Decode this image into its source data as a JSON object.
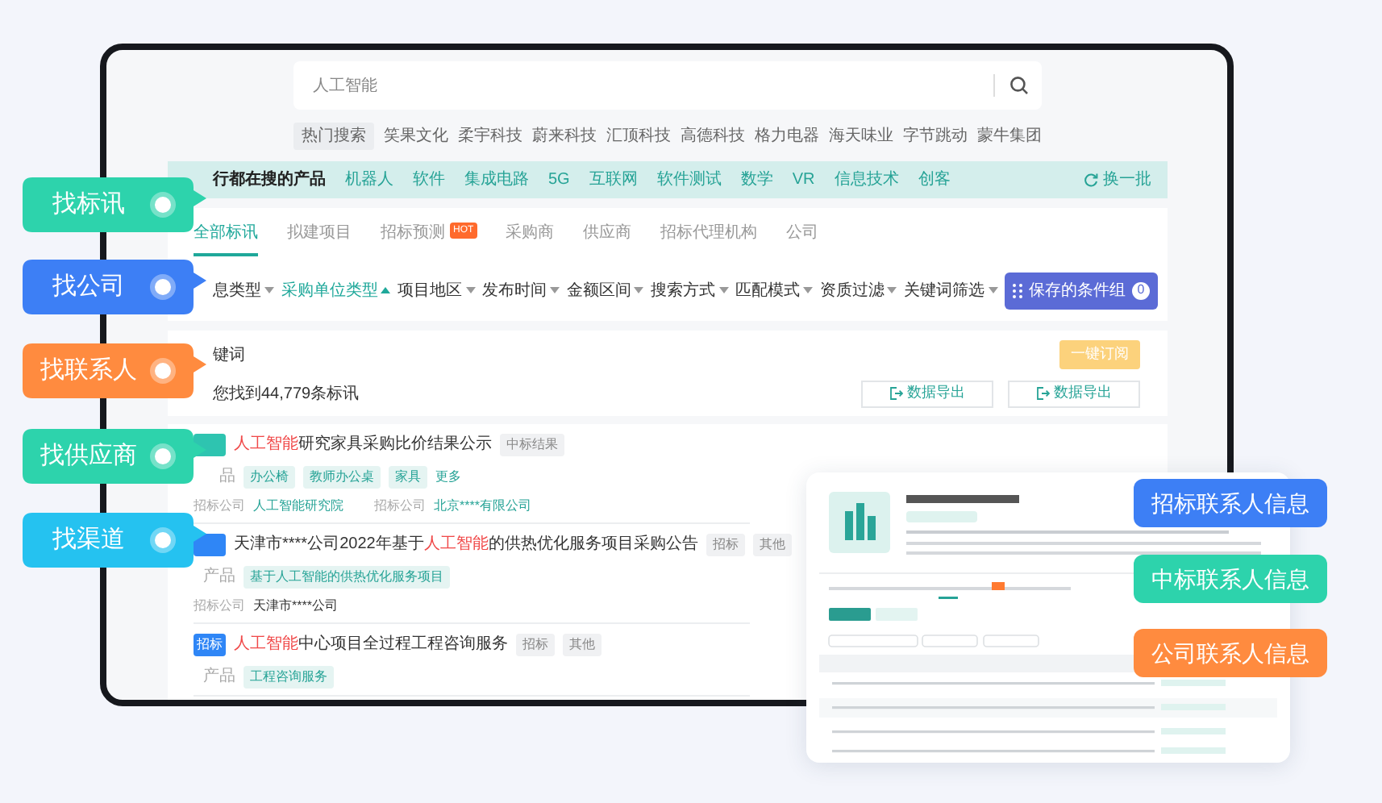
{
  "search": {
    "placeholder": "人工智能"
  },
  "hot_search": {
    "label": "热门搜索",
    "items": [
      "笑果文化",
      "柔宇科技",
      "蔚来科技",
      "汇顶科技",
      "高德科技",
      "格力电器",
      "海天味业",
      "字节跳动",
      "蒙牛集团"
    ]
  },
  "popular_products": {
    "title": "行都在搜的产品",
    "items": [
      "机器人",
      "软件",
      "集成电路",
      "5G",
      "互联网",
      "软件测试",
      "数学",
      "VR",
      "信息技术",
      "创客"
    ],
    "refresh": "换一批"
  },
  "tabs": [
    {
      "label": "全部标讯",
      "selected": true
    },
    {
      "label": "拟建项目",
      "selected": false
    },
    {
      "label": "招标预测",
      "selected": false,
      "badge": "HOT"
    },
    {
      "label": "采购商",
      "selected": false
    },
    {
      "label": "供应商",
      "selected": false
    },
    {
      "label": "招标代理机构",
      "selected": false
    },
    {
      "label": "公司",
      "selected": false
    }
  ],
  "filters": [
    {
      "label": "息类型",
      "selected": false
    },
    {
      "label": "采购单位类型",
      "selected": true
    },
    {
      "label": "项目地区",
      "selected": false
    },
    {
      "label": "发布时间",
      "selected": false
    },
    {
      "label": "金额区间",
      "selected": false
    },
    {
      "label": "搜索方式",
      "selected": false
    },
    {
      "label": "匹配模式",
      "selected": false
    },
    {
      "label": "资质过滤",
      "selected": false
    },
    {
      "label": "关键词筛选",
      "selected": false
    }
  ],
  "saved_conditions": {
    "label": "保存的条件组",
    "count": "0"
  },
  "keyword_label": "键词",
  "subscribe_button": "一键订阅",
  "result_count": "您找到44,779条标讯",
  "export_buttons": [
    "数据导出",
    "数据导出"
  ],
  "results": [
    {
      "badge": {
        "color": "#2ec4b0"
      },
      "title": [
        {
          "text": "人工智能",
          "highlight": true
        },
        {
          "text": "研究家具采购比价结果公示",
          "highlight": false
        }
      ],
      "tags": [
        "中标结果"
      ],
      "product_label": "品",
      "products": [
        {
          "text": "办公椅",
          "kind": "tag"
        },
        {
          "text": "教师办公桌",
          "kind": "tag"
        },
        {
          "text": "家具",
          "kind": "tag"
        },
        {
          "text": "更多",
          "kind": "link"
        }
      ],
      "companies": [
        {
          "label": "招标公司",
          "name": "人工智能研究院",
          "kind": "link"
        },
        {
          "label": "招标公司",
          "name": "北京****有限公司",
          "kind": "link"
        }
      ]
    },
    {
      "badge": {
        "color": "#2f86f6"
      },
      "title": [
        {
          "text": "天津市****公司2022年基于",
          "highlight": false
        },
        {
          "text": "人工智能",
          "highlight": true
        },
        {
          "text": "的供热优化服务项目采购公告",
          "highlight": false
        }
      ],
      "tags": [
        "招标",
        "其他"
      ],
      "product_label": "产品",
      "products": [
        {
          "text": "基于人工智能的供热优化服务项目",
          "kind": "tag"
        }
      ],
      "companies": [
        {
          "label": "招标公司",
          "name": "天津市****公司",
          "kind": "plain"
        }
      ]
    },
    {
      "badge": {
        "color": "#2f86f6",
        "text": "招标"
      },
      "title": [
        {
          "text": "人工智能",
          "highlight": true
        },
        {
          "text": "中心项目全过程工程咨询服务",
          "highlight": false
        }
      ],
      "tags": [
        "招标",
        "其他"
      ],
      "product_label": "产品",
      "products": [
        {
          "text": "工程咨询服务",
          "kind": "tag"
        }
      ]
    }
  ],
  "left_labels": [
    {
      "text": "找标讯",
      "color": "#2dd3ac"
    },
    {
      "text": "找公司",
      "color": "#3d7ff5"
    },
    {
      "text": "找联系人",
      "color": "#ff8b3f"
    },
    {
      "text": "找供应商",
      "color": "#2dd3ac"
    },
    {
      "text": "找渠道",
      "color": "#25c2f0"
    }
  ],
  "right_labels": [
    {
      "text": "招标联系人信息",
      "color": "#3d7ff5"
    },
    {
      "text": "中标联系人信息",
      "color": "#2dd3ac"
    },
    {
      "text": "公司联系人信息",
      "color": "#ff8b3f"
    }
  ]
}
